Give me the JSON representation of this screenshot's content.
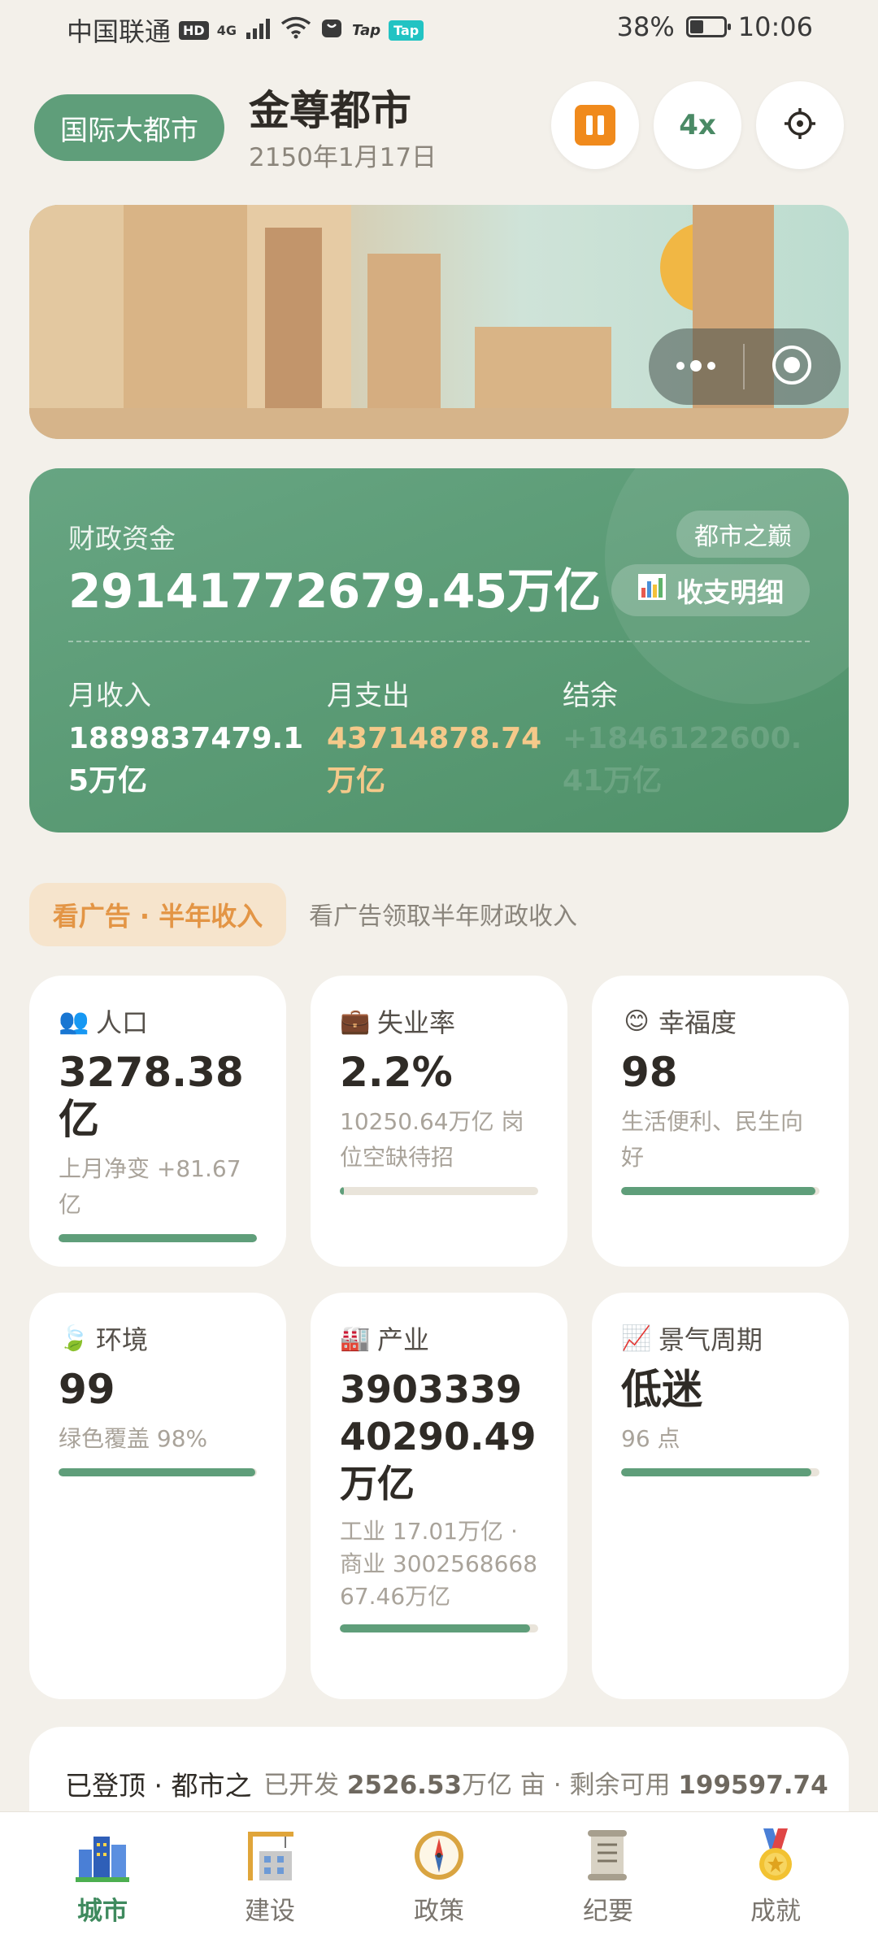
{
  "status_bar": {
    "carrier": "中国联通",
    "badges": [
      "HD",
      "4G"
    ],
    "tap_badges": [
      "Tap",
      "Tap"
    ],
    "battery": "38%",
    "time": "10:06"
  },
  "header": {
    "city_tag": "国际大都市",
    "city_name": "金尊都市",
    "date": "2150年1月17日",
    "speed": "4x",
    "icons": [
      "pause-icon",
      "settings-icon"
    ]
  },
  "finance": {
    "label": "财政资金",
    "amount": "29141772679.45万亿",
    "peak_badge": "都市之巅",
    "detail_button": "收支明细",
    "income_label": "月收入",
    "income_value": "1889837479.15万亿",
    "expense_label": "月支出",
    "expense_value": "43714878.74万亿",
    "balance_label": "结余",
    "balance_value": "+1846122600.41万亿"
  },
  "ad": {
    "button": "看广告 · 半年收入",
    "description": "看广告领取半年财政收入"
  },
  "stats": {
    "population": {
      "title": "人口",
      "value": "3278.38亿",
      "sub": "上月净变 +81.67亿",
      "progress": 1.0,
      "icon": "people-icon"
    },
    "unemployment": {
      "title": "失业率",
      "value": "2.2%",
      "sub": "10250.64万亿 岗位空缺待招",
      "progress": 0.022,
      "icon": "briefcase-icon"
    },
    "happiness": {
      "title": "幸福度",
      "value": "98",
      "sub": "生活便利、民生向好",
      "progress": 0.98,
      "icon": "smile-icon"
    },
    "environment": {
      "title": "环境",
      "value": "99",
      "sub": "绿色覆盖 98%",
      "progress": 0.99,
      "icon": "leaf-icon"
    },
    "industry": {
      "title": "产业",
      "value": "390333940290.49万亿",
      "sub": "工业 17.01万亿 · 商业 300256866867.46万亿",
      "progress": 0.96,
      "icon": "factory-icon"
    },
    "cycle": {
      "title": "景气周期",
      "value": "低迷",
      "sub": "96 点",
      "progress": 0.96,
      "icon": "chart-up-icon"
    }
  },
  "info": {
    "title": "已登顶 · 都市之",
    "developed_prefix": "已开发",
    "developed_value": "2526.53",
    "developed_unit": "万亿 亩 · 剩余可用",
    "remaining_value": "199597.74"
  },
  "nav": {
    "items": [
      {
        "label": "城市",
        "icon": "city-icon",
        "active": true
      },
      {
        "label": "建设",
        "icon": "construction-icon",
        "active": false
      },
      {
        "label": "政策",
        "icon": "compass-icon",
        "active": false
      },
      {
        "label": "纪要",
        "icon": "scroll-icon",
        "active": false
      },
      {
        "label": "成就",
        "icon": "medal-icon",
        "active": false
      }
    ]
  },
  "colors": {
    "accent_green": "#5f9e7a",
    "expense_orange": "#f5c98a",
    "pause_orange": "#f08a1c",
    "background": "#f3f0ea"
  }
}
